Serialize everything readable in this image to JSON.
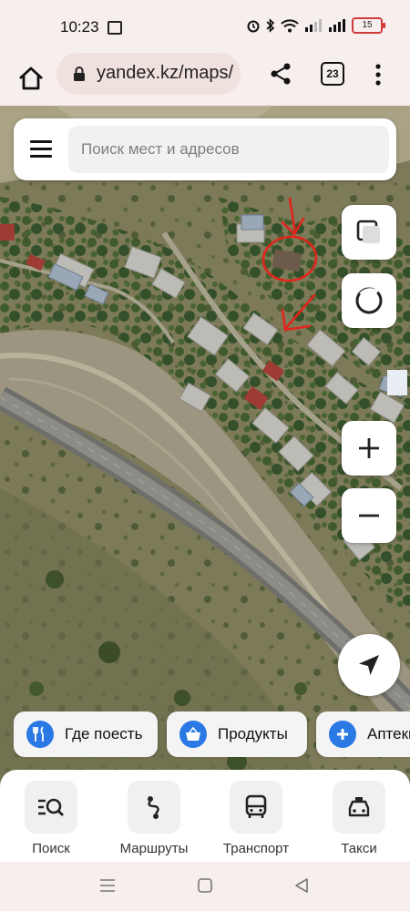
{
  "status_bar": {
    "time": "10:23",
    "battery": "15"
  },
  "browser": {
    "url": "yandex.kz/maps/",
    "tab_count": "23"
  },
  "search": {
    "placeholder": "Поиск мест и адресов"
  },
  "categories": [
    {
      "label": "Где поесть",
      "icon": "fork-knife-icon"
    },
    {
      "label": "Продукты",
      "icon": "basket-icon"
    },
    {
      "label": "Аптеки",
      "icon": "plus-icon"
    }
  ],
  "bottom_nav": [
    {
      "label": "Поиск",
      "icon": "search-list-icon"
    },
    {
      "label": "Маршруты",
      "icon": "route-icon"
    },
    {
      "label": "Транспорт",
      "icon": "bus-icon"
    },
    {
      "label": "Такси",
      "icon": "taxi-icon"
    }
  ],
  "colors": {
    "accent": "#2a79e4",
    "annotation": "#e0261b"
  }
}
